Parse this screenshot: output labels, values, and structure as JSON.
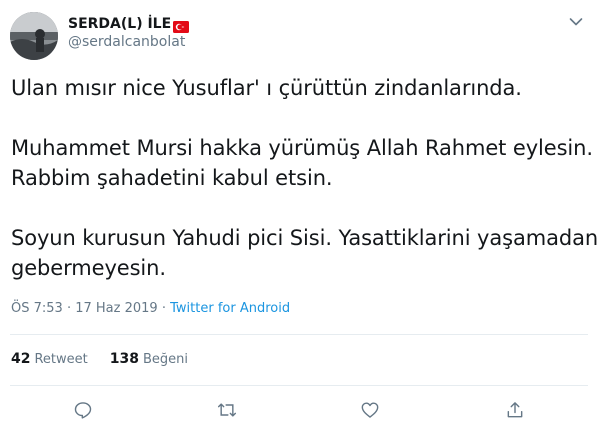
{
  "user": {
    "display_name": "SERDA(L) İLE",
    "flag_icon": "turkey-flag-icon",
    "username": "@serdalcanbolat",
    "avatar_icon": "avatar-photo"
  },
  "tweet": {
    "lines": [
      "Ulan mısır nice Yusuflar' ı çürüttün zindanlarında.",
      "Muhammet Mursi hakka yürümüş Allah Rahmet eylesin.",
      "Rabbim şahadetini kabul etsin.",
      "Soyun kurusun Yahudi pici Sisi. Yasattiklarini yaşamadan",
      "gebermeyesin."
    ]
  },
  "meta": {
    "time": "ÖS 7:53",
    "separator": "·",
    "date": "17 Haz 2019",
    "separator2": "·",
    "source": "Twitter for Android"
  },
  "stats": {
    "retweets_count": "42",
    "retweets_label": "Retweet",
    "likes_count": "138",
    "likes_label": "Beğeni"
  },
  "actions": {
    "reply_icon": "reply-icon",
    "retweet_icon": "retweet-icon",
    "like_icon": "heart-icon",
    "share_icon": "share-icon"
  },
  "colors": {
    "text": "#14171a",
    "secondary": "#657786",
    "link": "#1b95e0",
    "divider": "#e6ecf0",
    "flag_red": "#e30a17"
  }
}
